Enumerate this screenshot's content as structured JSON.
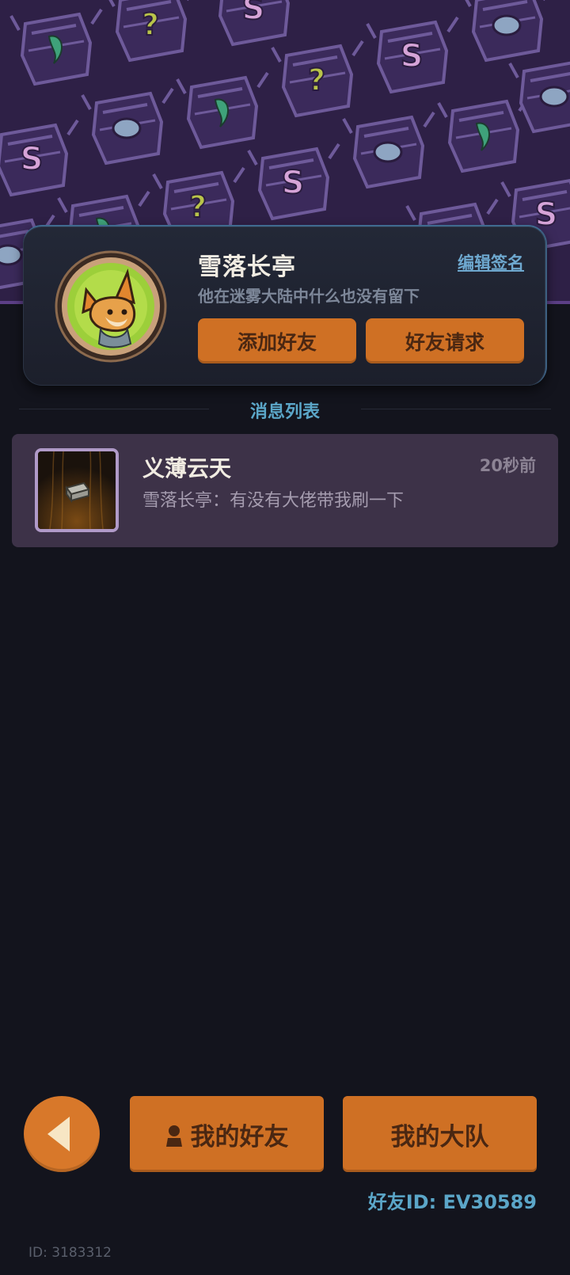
{
  "profile": {
    "name": "雪落长亭",
    "signature": "他在迷雾大陆中什么也没有留下",
    "edit_signature_label": "编辑签名",
    "add_friend_label": "添加好友",
    "friend_request_label": "好友请求"
  },
  "messages": {
    "section_title": "消息列表",
    "items": [
      {
        "sender": "义薄云天",
        "time": "20秒前",
        "preview": "雪落长亭：有没有大佬带我刷一下"
      }
    ]
  },
  "footer": {
    "my_friends_label": "我的好友",
    "my_team_label": "我的大队",
    "friend_id": "好友ID: EV30589",
    "user_id": "ID: 3183312"
  },
  "colors": {
    "background": "#13141d",
    "banner": "#2e2046",
    "accent_orange": "#cf7024",
    "accent_blue": "#5ba6c8",
    "message_row": "#3d3248"
  }
}
